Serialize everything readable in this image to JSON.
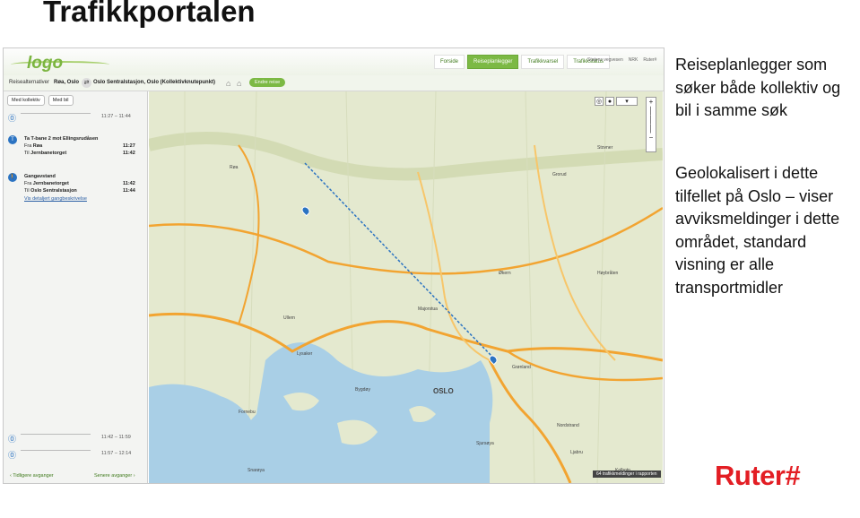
{
  "slide": {
    "title": "Trafikkportalen",
    "description_1": "Reiseplanlegger som søker både kollektiv og bil i samme søk",
    "description_2": "Geolokalisert i dette tilfellet på Oslo – viser avviksmeldinger i dette området, standard visning er alle transportmidler",
    "brand": "Ruter#"
  },
  "app": {
    "logo": "logo",
    "nav_tabs": [
      "Forside",
      "Reiseplanlegger",
      "Trafikkvarsel",
      "Trafikkstatus"
    ],
    "active_tab": "Reiseplanlegger",
    "partners": [
      "Statens vegvesen",
      "NRK",
      "Ruter#"
    ],
    "search": {
      "label": "Reisealternativer",
      "from": "Røa, Oslo",
      "to": "Oslo Sentralstasjon, Oslo (Kollektivknutepunkt)",
      "edit_button": "Endre reise"
    },
    "sidebar": {
      "tools": [
        "Med kollektiv",
        "Med bil"
      ],
      "top_alternative": {
        "mode": "T-bane",
        "time": "11:27 – 11:44"
      },
      "legs": [
        {
          "head": "Ta T-bane 2 mot Ellingsrudåsen",
          "from_label": "Fra",
          "from": "Røa",
          "to_label": "Til",
          "to": "Jernbanetorget",
          "dep": "11:27",
          "arr": "11:42"
        },
        {
          "head": "Gangavstand",
          "from_label": "Fra",
          "from": "Jernbanetorget",
          "to_label": "Til",
          "to": "Oslo Sentralstasjon",
          "dep": "11:42",
          "arr": "11:44",
          "link": "Vis detaljert gangbeskrivelse"
        }
      ],
      "bottom_alternatives": [
        {
          "mode": "T-bane",
          "time": "11:42 – 11:59"
        },
        {
          "mode": "T-bane",
          "time": "11:57 – 12:14"
        }
      ],
      "prev_label": "Tidligere avganger",
      "next_label": "Senere avganger"
    },
    "map": {
      "city_label": "OSLO",
      "place_labels": [
        "Røa",
        "Ullern",
        "Bygdøy",
        "Grorud",
        "Stovner",
        "Nordstrand",
        "Sjursøya",
        "Grønland",
        "Snarøya",
        "Fornebu",
        "Majorstua",
        "Økern",
        "Lysaker",
        "Høybråten",
        "Ljabru",
        "Kolbotn"
      ],
      "status_text": "64 trafikkmeldinger i rapporten"
    },
    "colors": {
      "accent": "#7cb944",
      "brand": "#e31e24",
      "water": "#a9cfe6"
    }
  }
}
